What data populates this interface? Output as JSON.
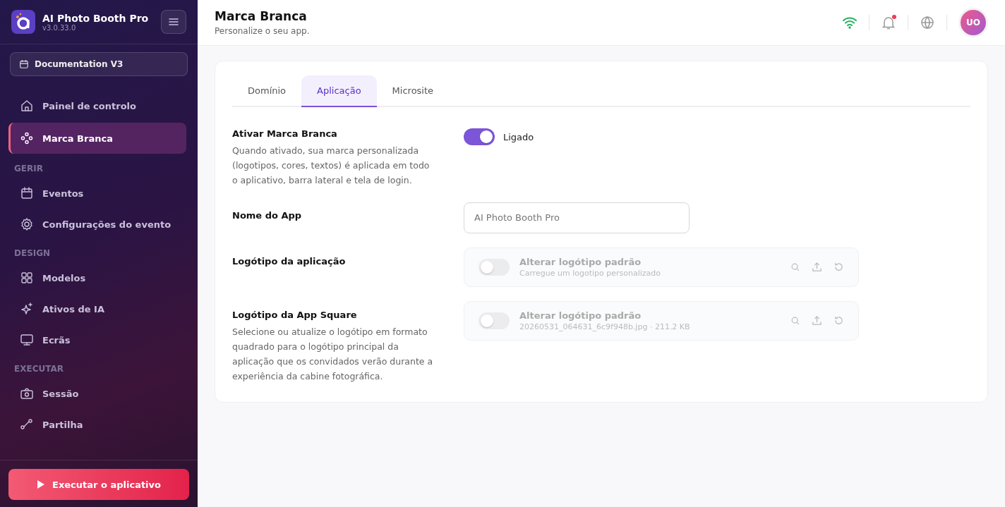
{
  "sidebar": {
    "app_name": "AI Photo Booth Pro",
    "version": "v3.0.33.0",
    "event_selector": "Documentation V3",
    "sections": [
      {
        "items": [
          {
            "label": "Painel de controlo",
            "selected": false
          },
          {
            "label": "Marca Branca",
            "selected": true
          }
        ]
      },
      {
        "title": "GERIR",
        "items": [
          {
            "label": "Eventos",
            "selected": false
          },
          {
            "label": "Configurações do evento",
            "selected": false
          }
        ]
      },
      {
        "title": "DESIGN",
        "items": [
          {
            "label": "Modelos",
            "selected": false
          },
          {
            "label": "Ativos de IA",
            "selected": false
          },
          {
            "label": "Ecrãs",
            "selected": false
          }
        ]
      },
      {
        "title": "EXECUTAR",
        "items": [
          {
            "label": "Sessão",
            "selected": false
          },
          {
            "label": "Partilha",
            "selected": false
          }
        ]
      }
    ],
    "run_button": "Executar o aplicativo"
  },
  "header": {
    "title": "Marca Branca",
    "subtitle": "Personalize o seu app.",
    "notification_dot": true,
    "avatar": "UO"
  },
  "tabs": [
    {
      "label": "Domínio",
      "selected": false
    },
    {
      "label": "Aplicação",
      "selected": true
    },
    {
      "label": "Microsite",
      "selected": false
    }
  ],
  "settings": [
    {
      "kind": "toggle",
      "label": "Ativar Marca Branca",
      "description": "Quando ativado, sua marca personalizada (logotipos, cores, textos) é aplicada em todo o aplicativo, barra lateral e tela de login.",
      "on": true,
      "state_label": "Ligado"
    },
    {
      "kind": "input",
      "label": "Nome do App",
      "placeholder": "AI Photo Booth Pro"
    },
    {
      "kind": "logo",
      "label": "Logótipo da aplicação",
      "on": false,
      "title": "Alterar logótipo padrão",
      "detail": "Carregue um logotipo personalizado"
    },
    {
      "kind": "logo",
      "label": "Logótipo da App Square",
      "description": "Selecione ou atualize o logótipo em formato quadrado para o logótipo principal da aplicação que os convidados verão durante a experiência da cabine fotográfica.",
      "on": false,
      "title": "Alterar logótipo padrão",
      "detail": "20260531_064631_6c9f948b.jpg · 211.2 KB"
    }
  ]
}
